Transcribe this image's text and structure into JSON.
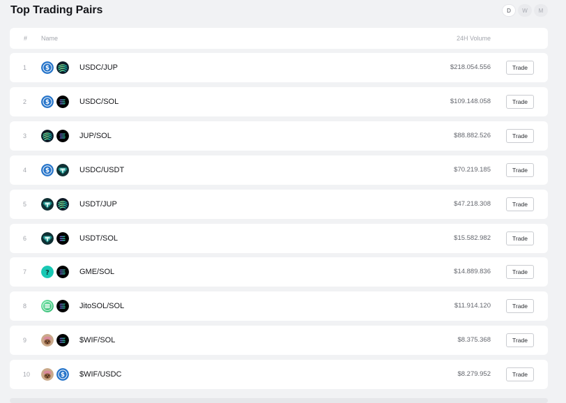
{
  "page": {
    "title": "Top Trading Pairs"
  },
  "range": {
    "options": [
      "D",
      "W",
      "M"
    ],
    "selected": "D"
  },
  "table": {
    "headers": {
      "rank": "#",
      "name": "Name",
      "volume": "24H Volume"
    },
    "trade_label": "Trade",
    "rows": [
      {
        "rank": "1",
        "pair": "USDC/JUP",
        "volume": "$218.054.556",
        "icons": [
          "usdc-icon",
          "jup-icon"
        ]
      },
      {
        "rank": "2",
        "pair": "USDC/SOL",
        "volume": "$109.148.058",
        "icons": [
          "usdc-icon",
          "sol-icon"
        ]
      },
      {
        "rank": "3",
        "pair": "JUP/SOL",
        "volume": "$88.882.526",
        "icons": [
          "jup-icon",
          "sol-icon"
        ]
      },
      {
        "rank": "4",
        "pair": "USDC/USDT",
        "volume": "$70.219.185",
        "icons": [
          "usdc-icon",
          "usdt-icon"
        ]
      },
      {
        "rank": "5",
        "pair": "USDT/JUP",
        "volume": "$47.218.308",
        "icons": [
          "usdt-icon",
          "jup-icon"
        ]
      },
      {
        "rank": "6",
        "pair": "USDT/SOL",
        "volume": "$15.582.982",
        "icons": [
          "usdt-icon",
          "sol-icon"
        ]
      },
      {
        "rank": "7",
        "pair": "GME/SOL",
        "volume": "$14.889.836",
        "icons": [
          "unknown-token-icon",
          "sol-icon"
        ]
      },
      {
        "rank": "8",
        "pair": "JitoSOL/SOL",
        "volume": "$11.914.120",
        "icons": [
          "jitosol-icon",
          "sol-icon"
        ]
      },
      {
        "rank": "9",
        "pair": "$WIF/SOL",
        "volume": "$8.375.368",
        "icons": [
          "wif-icon",
          "sol-icon"
        ]
      },
      {
        "rank": "10",
        "pair": "$WIF/USDC",
        "volume": "$8.279.952",
        "icons": [
          "wif-icon",
          "usdc-icon"
        ]
      }
    ]
  },
  "colors": {
    "background": "#f1f2f4",
    "card": "#ffffff",
    "usdc": "#2775ca",
    "jup": "#19c3a6",
    "sol": "#9945ff",
    "usdt": "#0f6a6a",
    "unknown": "#19c8b4"
  }
}
